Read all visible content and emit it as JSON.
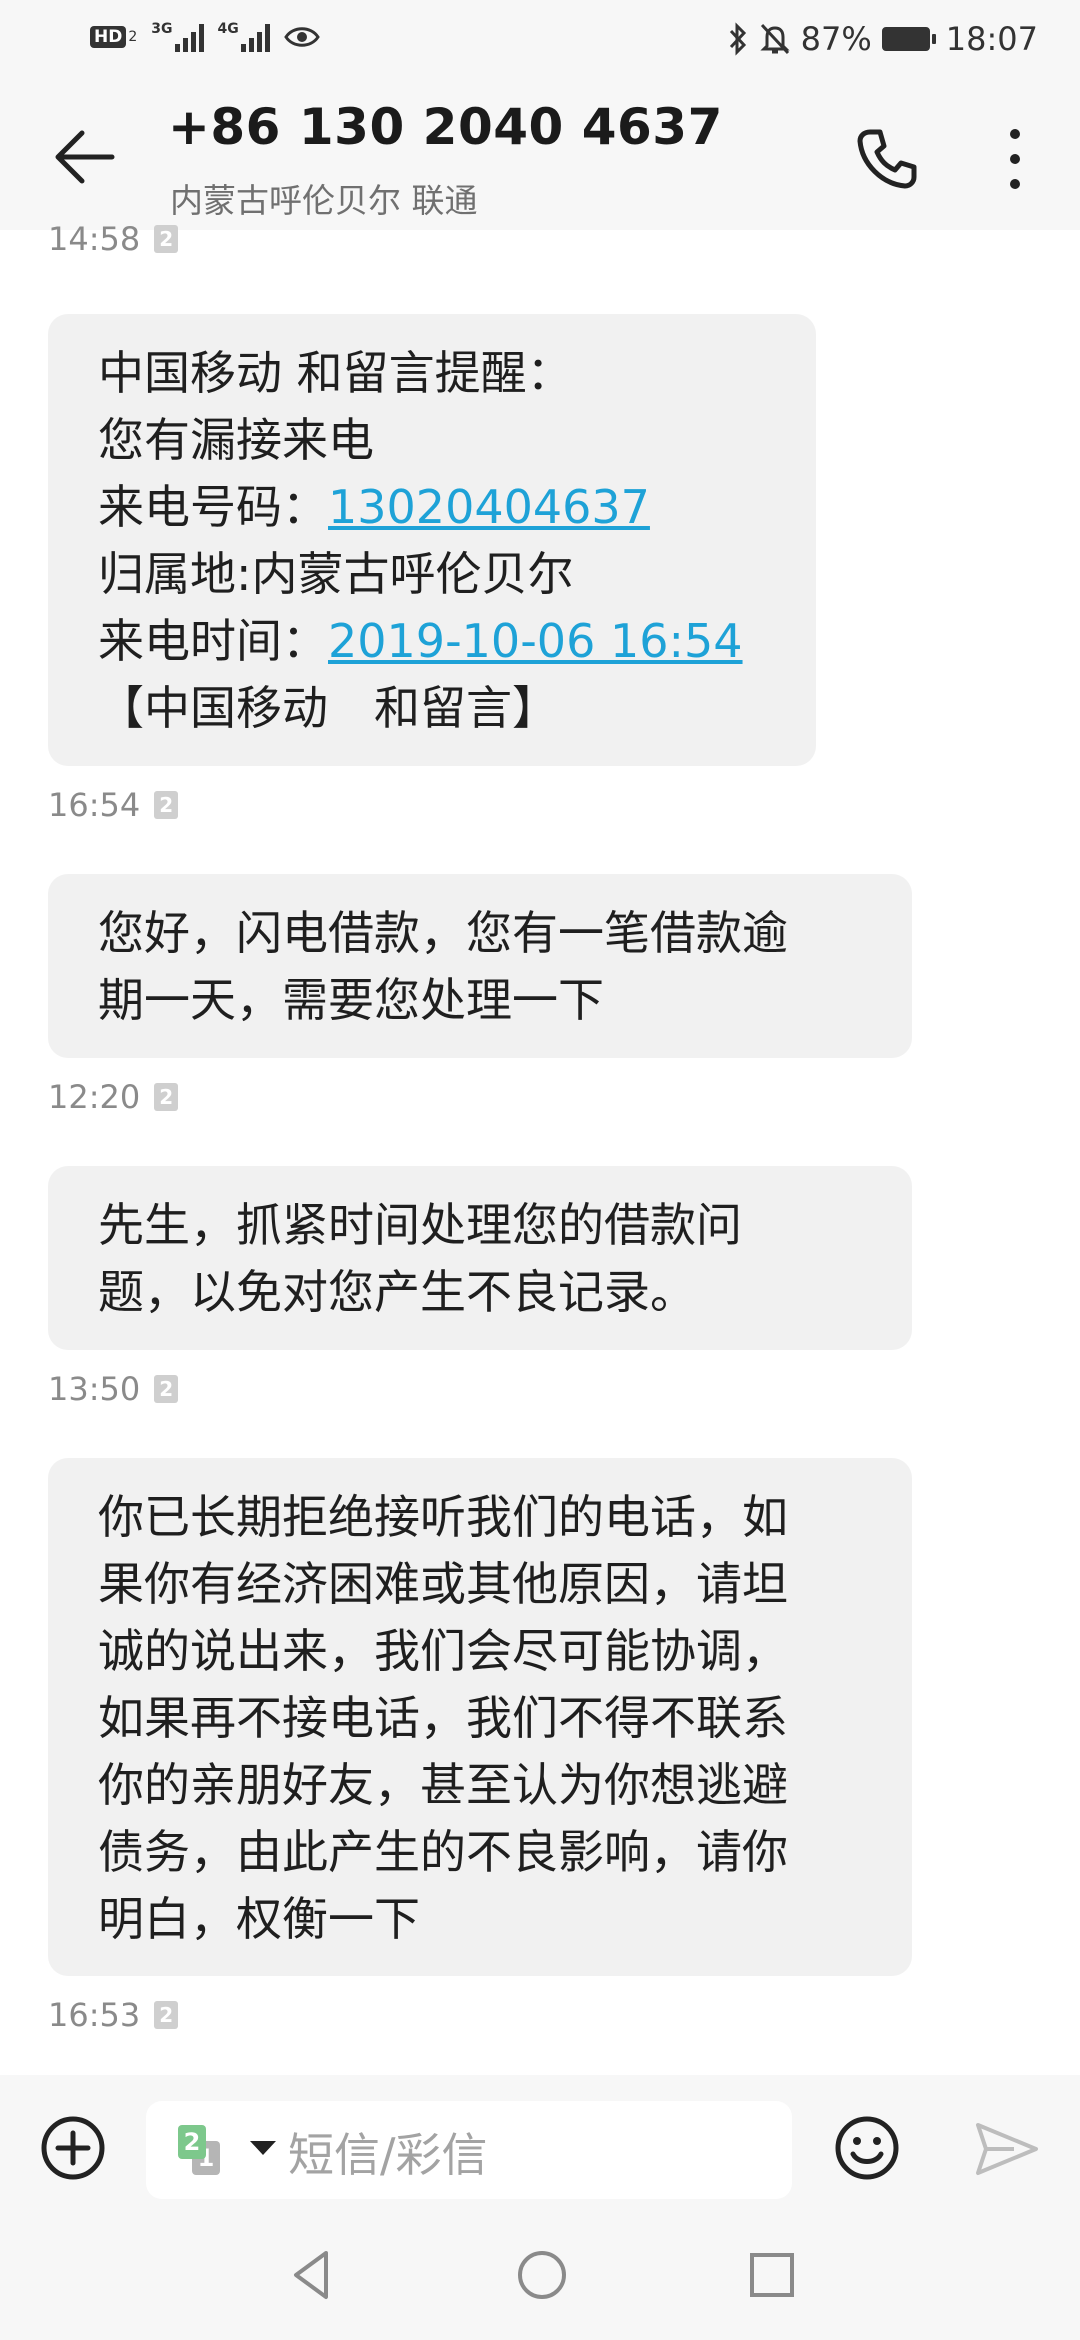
{
  "status_bar": {
    "hd_label": "HD",
    "hd_sub": "2",
    "net1_label": "3G",
    "net2_label": "4G",
    "battery_percent": "87%",
    "time": "18:07"
  },
  "header": {
    "title": "+86 130 2040 4637",
    "subtitle": "内蒙古呼伦贝尔 联通"
  },
  "messages": [
    {
      "time": "14:58",
      "sim": "2"
    },
    {
      "lines": [
        "中国移动 和留言提醒：",
        "您有漏接来电",
        "来电号码：",
        "归属地:内蒙古呼伦贝尔",
        "来电时间：",
        "【中国移动　和留言】"
      ],
      "phone_link": "13020404637",
      "time_link": "2019-10-06 16:54",
      "time": "16:54",
      "sim": "2"
    },
    {
      "lines": [
        "您好，闪电借款，您有一笔借款逾",
        "期一天，需要您处理一下"
      ],
      "time": "12:20",
      "sim": "2"
    },
    {
      "lines": [
        "先生，抓紧时间处理您的借款问",
        "题，以免对您产生不良记录。"
      ],
      "time": "13:50",
      "sim": "2"
    },
    {
      "lines": [
        "你已长期拒绝接听我们的电话，如",
        "果你有经济困难或其他原因，请坦",
        "诚的说出来，我们会尽可能协调，",
        "如果再不接电话，我们不得不联系",
        "你的亲朋好友，甚至认为你想逃避",
        "债务，由此产生的不良影响，请你",
        "明白，权衡一下"
      ],
      "time": "16:53",
      "sim": "2"
    }
  ],
  "compose": {
    "sim_primary": "2",
    "sim_secondary": "1",
    "placeholder": "短信/彩信"
  },
  "colors": {
    "link": "#1ea2d7",
    "bubble": "#f1f1f1",
    "bar_bg": "#f7f7f7"
  }
}
